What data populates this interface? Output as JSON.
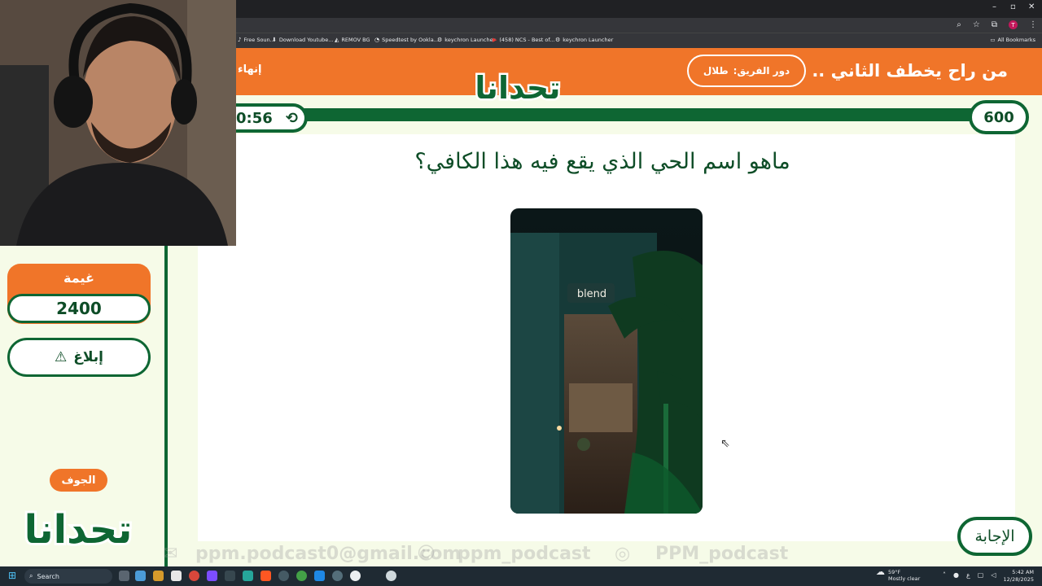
{
  "browser": {
    "bookmarks": [
      {
        "icon": "♪",
        "label": "Free Soun..."
      },
      {
        "icon": "⬇",
        "label": "Download Youtube..."
      },
      {
        "icon": "◭",
        "label": "REMOV BG"
      },
      {
        "icon": "◔",
        "label": "Speedtest by Ookla..."
      },
      {
        "icon": "⚙",
        "label": "keychron Launcher"
      },
      {
        "icon": "▶",
        "label": "(458) NCS - Best of..."
      },
      {
        "icon": "⚙",
        "label": "keychron Launcher"
      }
    ],
    "all_bookmarks": "All Bookmarks",
    "profile_initial": "T",
    "window_controls": {
      "minimize": "–",
      "restore": "▫",
      "close": "✕"
    }
  },
  "game": {
    "header_question": "من راح يخطف الثاني ..",
    "turn_label": "دور الفريق:",
    "turn_team": "طلال",
    "end_label": "إنهاء",
    "logo_text": "تحدانا",
    "timer": "0:56",
    "points": "600",
    "question": "ماهو اسم الحي الذي  يقع فيه هذا الكافي؟",
    "photo_sign": "blend",
    "answer_label": "الإجابة"
  },
  "sidebar": {
    "team_name": "غيمة",
    "team_score": "2400",
    "report_label": "إبلاغ",
    "region": "الجوف",
    "logo_text": "تحدانا"
  },
  "watermark": {
    "email": "ppm.podcast0@gmail.com",
    "snap": "ppm_podcast",
    "insta": "PPM_podcast"
  },
  "taskbar": {
    "search_placeholder": "Search",
    "weather_temp": "59°F",
    "weather_text": "Mostly clear",
    "lang": "ع",
    "time": "5:42 AM",
    "date": "12/28/2025"
  }
}
